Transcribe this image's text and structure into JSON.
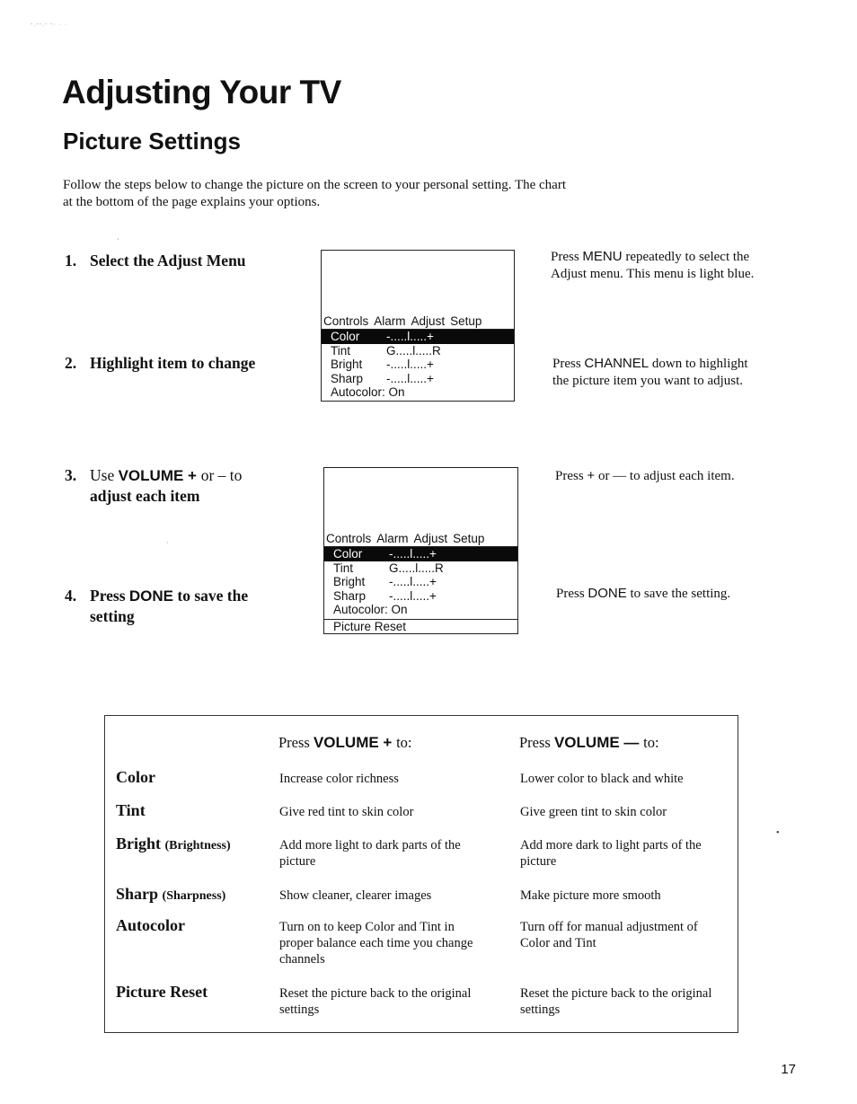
{
  "scan_mark": "-.--.- -·  ·  ·",
  "page_title": "Adjusting Your TV",
  "section_title": "Picture Settings",
  "intro": "Follow the steps below to change the picture on the screen to your personal setting.  The chart at the bottom of the page explains your options.",
  "steps": [
    {
      "num": "1.",
      "text": "Select the Adjust Menu",
      "description": {
        "pre": "Press ",
        "key": "MENU",
        "post": " repeatedly to select the Adjust menu.  This menu is light blue."
      }
    },
    {
      "num": "2.",
      "text": "Highlight item to change",
      "description": {
        "pre": "Press ",
        "key": "CHANNEL",
        "post": " down to highlight the picture item you want to adjust."
      }
    },
    {
      "num": "3.",
      "pre": "Use ",
      "key": "VOLUME + ",
      "mid": "or – to",
      "line2": "adjust each item",
      "description": {
        "pre": "Press ",
        "key": "+",
        "post": " or — to adjust each item."
      }
    },
    {
      "num": "4.",
      "pre": "Press ",
      "key": "DONE",
      "mid": " to save the",
      "line2": "setting",
      "description": {
        "pre": "Press ",
        "key": "DONE",
        "post": " to save the setting."
      }
    }
  ],
  "tv_screen_1": {
    "menu_bar": [
      "Controls",
      "Alarm",
      "Adjust",
      "Setup"
    ],
    "rows": [
      {
        "label": "Color",
        "value": "-.....l.....+",
        "selected": true
      },
      {
        "label": "Tint",
        "value": "G.....l.....R",
        "selected": false
      },
      {
        "label": "Bright",
        "value": "-.....l.....+",
        "selected": false
      },
      {
        "label": "Sharp",
        "value": "-.....l.....+",
        "selected": false
      },
      {
        "label": "Autocolor: On",
        "value": "",
        "selected": false
      }
    ]
  },
  "tv_screen_2": {
    "menu_bar": [
      "Controls",
      "Alarm",
      "Adjust",
      "Setup"
    ],
    "rows": [
      {
        "label": "Color",
        "value": "-.....l.....+",
        "selected": true
      },
      {
        "label": "Tint",
        "value": "G.....l.....R",
        "selected": false
      },
      {
        "label": "Bright",
        "value": "-.....l.....+",
        "selected": false
      },
      {
        "label": "Sharp",
        "value": "-.....l.....+",
        "selected": false
      },
      {
        "label": "Autocolor: On",
        "value": "",
        "selected": false
      }
    ],
    "reset_row": "Picture Reset"
  },
  "options_table": {
    "header_plus": {
      "pre": "Press ",
      "key": "VOLUME + ",
      "post": "to:"
    },
    "header_minus": {
      "pre": "Press ",
      "key": "VOLUME — ",
      "post": "to:"
    },
    "rows": [
      {
        "name": "Color",
        "paren": "",
        "plus": "Increase color richness",
        "minus": "Lower color to black and white"
      },
      {
        "name": "Tint",
        "paren": "",
        "plus": "Give red tint to skin color",
        "minus": "Give green tint to skin color"
      },
      {
        "name": "Bright ",
        "paren": "(Brightness)",
        "plus": "Add more light to dark parts of the picture",
        "minus": "Add more dark to light parts of the picture"
      },
      {
        "name": "Sharp ",
        "paren": "(Sharpness)",
        "plus": "Show cleaner, clearer images",
        "minus": "Make picture more smooth"
      },
      {
        "name": "Autocolor",
        "paren": "",
        "plus": "Turn on to keep Color and Tint in proper balance each time you change channels",
        "minus": "Turn off for manual adjustment of Color and Tint"
      },
      {
        "name": "Picture Reset",
        "paren": "",
        "plus": "Reset the picture back to the original settings",
        "minus": "Reset the picture back to the original settings"
      }
    ]
  },
  "page_number": "17"
}
